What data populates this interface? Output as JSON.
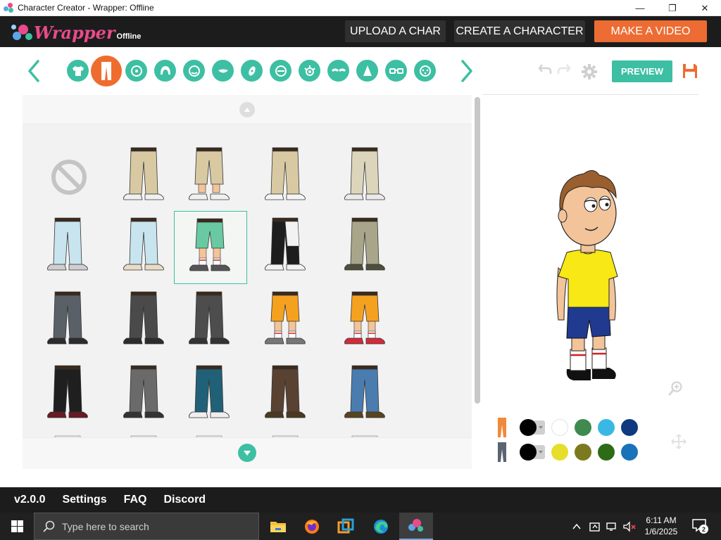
{
  "window": {
    "title": "Character Creator - Wrapper: Offline",
    "controls": {
      "minimize": "—",
      "maximize": "❐",
      "close": "✕"
    }
  },
  "header": {
    "logo_word": "Wrapper",
    "logo_sub": "Offline",
    "buttons": {
      "upload": "UPLOAD A CHAR",
      "create": "CREATE A CHARACTER",
      "make_video": "MAKE A VIDEO"
    },
    "accent": "#ec6c33"
  },
  "toolbar": {
    "categories": [
      "shirt-icon",
      "pants-icon",
      "head-shape-icon",
      "hair-icon",
      "face-shape-icon",
      "mouth-icon",
      "accessory-icon",
      "beard-icon",
      "eye-icon",
      "eyebrow-icon",
      "nose-icon",
      "glasses-icon",
      "mole-icon"
    ],
    "selected_category": "pants-icon",
    "preview_label": "PREVIEW",
    "accent": "#3dbfa3",
    "selected_color": "#ef6c2f"
  },
  "grid": {
    "selected_index": 7,
    "items": [
      {
        "name": "none-option",
        "kind": "none"
      },
      {
        "name": "khaki-pants-white-sandals",
        "kind": "pants",
        "pants": "#d9c9a3",
        "shoe": "#f0f0f0",
        "skin": false
      },
      {
        "name": "khaki-capris-sandals",
        "kind": "capri",
        "pants": "#d9c9a3",
        "shoe": "#f0f0f0",
        "skin": true
      },
      {
        "name": "khaki-pants-white-shoes",
        "kind": "pants",
        "pants": "#d9c9a3",
        "shoe": "#f4f4f4",
        "skin": false
      },
      {
        "name": "light-khaki-pants",
        "kind": "pants",
        "pants": "#dcd5bc",
        "shoe": "#eaeaea",
        "skin": false
      },
      {
        "name": "light-blue-pants-grey-shoes",
        "kind": "pants",
        "pants": "#c8e4ef",
        "shoe": "#cfcfcf",
        "skin": false
      },
      {
        "name": "light-blue-pants-sandals",
        "kind": "pants",
        "pants": "#c8e4ef",
        "shoe": "#e8dcc4",
        "skin": false
      },
      {
        "name": "green-shorts-black-shoes",
        "kind": "shorts",
        "pants": "#69c9a2",
        "shoe": "#555555",
        "skin": true
      },
      {
        "name": "black-white-track-pants",
        "kind": "track",
        "pants": "#1d1d1d",
        "shoe": "#f2f2f2",
        "skin": false
      },
      {
        "name": "camo-cargo-pants",
        "kind": "pants",
        "pants": "#a8a58a",
        "shoe": "#4e4e3c",
        "skin": false
      },
      {
        "name": "grey-jeans-black-boots",
        "kind": "pants",
        "pants": "#5a6068",
        "shoe": "#2c2c2c",
        "skin": false
      },
      {
        "name": "dark-grey-pants",
        "kind": "pants",
        "pants": "#4a4a4a",
        "shoe": "#2c2c2c",
        "skin": false
      },
      {
        "name": "ripped-grey-pants",
        "kind": "pants",
        "pants": "#4d4d4d",
        "shoe": "#333333",
        "skin": false
      },
      {
        "name": "orange-shorts-sneakers",
        "kind": "shorts",
        "pants": "#f5a120",
        "shoe": "#777777",
        "skin": true
      },
      {
        "name": "orange-shorts-red-sneakers",
        "kind": "shorts",
        "pants": "#f5a120",
        "shoe": "#d22b3a",
        "skin": true
      },
      {
        "name": "black-pants-red-boots",
        "kind": "pants",
        "pants": "#1f1f1f",
        "shoe": "#6a1a24",
        "skin": false
      },
      {
        "name": "grey-joggers-boots",
        "kind": "pants",
        "pants": "#6a6a6a",
        "shoe": "#333333",
        "skin": false
      },
      {
        "name": "teal-baggy-jeans",
        "kind": "pants",
        "pants": "#216178",
        "shoe": "#eeeeee",
        "skin": false
      },
      {
        "name": "brown-pants-boots",
        "kind": "pants",
        "pants": "#5a4233",
        "shoe": "#4b3a22",
        "skin": false
      },
      {
        "name": "blue-jeans-brown-boots",
        "kind": "pants",
        "pants": "#4a7cb0",
        "shoe": "#5a4420",
        "skin": false
      },
      {
        "name": "tan-pants-partial",
        "kind": "partial",
        "pants": "#b48a66",
        "shoe": "#b48a66",
        "skin": false
      },
      {
        "name": "cream-pants-partial",
        "kind": "partial",
        "pants": "#e2dcc8",
        "shoe": "#e2dcc8",
        "skin": false
      },
      {
        "name": "red-shorts-partial",
        "kind": "partial",
        "pants": "#c96f78",
        "shoe": "#c96f78",
        "skin": false
      },
      {
        "name": "beige-camo-partial",
        "kind": "partial",
        "pants": "#dcd6c2",
        "shoe": "#dcd6c2",
        "skin": false
      },
      {
        "name": "red-underwear-partial",
        "kind": "partial",
        "pants": "#8a8a8a",
        "shoe": "#8a8a8a",
        "skin": false
      }
    ]
  },
  "colors": {
    "upper_row": {
      "part": "pants-upper-icon",
      "swatches": [
        "#000000",
        "#ffffff",
        "#3f8a4f",
        "#39b8e3",
        "#0f3a80"
      ]
    },
    "lower_row": {
      "part": "pants-lower-icon",
      "swatches": [
        "#000000",
        "#e6de2a",
        "#7b7a1e",
        "#2e6b16",
        "#1a73b8"
      ]
    }
  },
  "footer": {
    "version": "v2.0.0",
    "settings": "Settings",
    "faq": "FAQ",
    "discord": "Discord"
  },
  "taskbar": {
    "search_placeholder": "Type here to search",
    "time": "6:11 AM",
    "date": "1/6/2025",
    "notifications": "2"
  }
}
